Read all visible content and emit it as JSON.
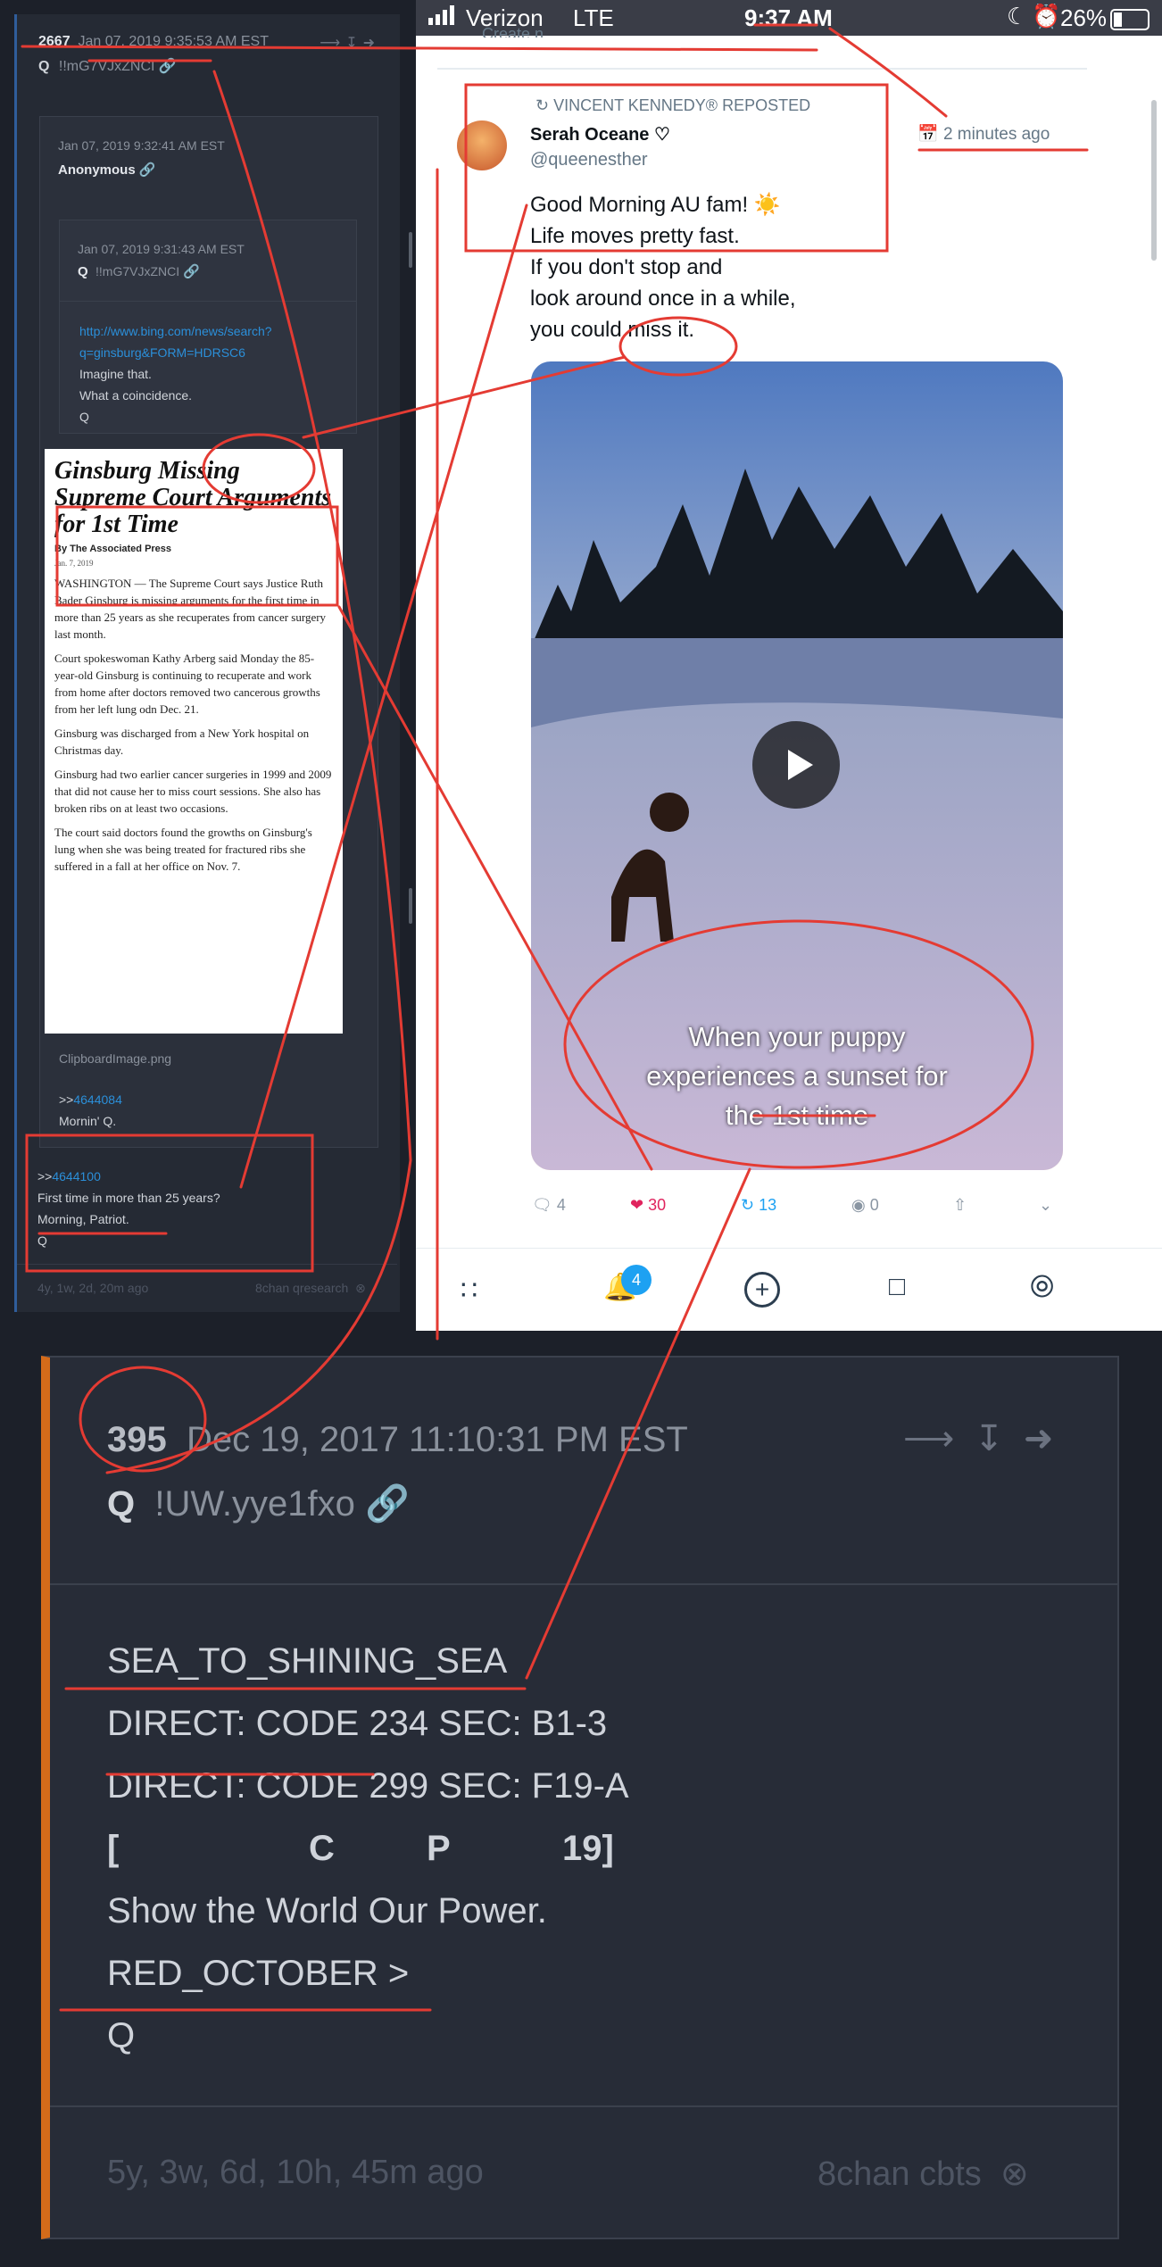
{
  "left_panel": {
    "post_number": "2667",
    "timestamp": "Jan 07, 2019 9:35:53 AM EST",
    "author_name": "Q",
    "tripcode": "!!mG7VJxZNCI",
    "quoted_post": {
      "timestamp": "Jan 07, 2019 9:32:41 AM EST",
      "author": "Anonymous",
      "nested_post": {
        "timestamp": "Jan 07, 2019 9:31:43 AM EST",
        "author_name": "Q",
        "tripcode": "!!mG7VJxZNCI",
        "link_line1": "http://www.bing.com/news/search?",
        "link_line2": "q=ginsburg&FORM=HDRSC6",
        "line1": "Imagine that.",
        "line2": "What a coincidence.",
        "sign": "Q"
      },
      "article": {
        "headline": "Ginsburg Missing Supreme Court Arguments for 1st Time",
        "byline": "By The Associated Press",
        "dateline": "Jan. 7, 2019",
        "paragraphs": [
          "WASHINGTON — The Supreme Court says Justice Ruth Bader Ginsburg is missing arguments for the first time in more than 25 years as she recuperates from cancer surgery last month.",
          "Court spokeswoman Kathy Arberg said Monday the 85-year-old Ginsburg is continuing to recuperate and work from home after doctors removed two cancerous growths from her left lung odn Dec. 21.",
          "Ginsburg was discharged from a New York hospital on Christmas day.",
          "Ginsburg had two earlier cancer surgeries in 1999 and 2009 that did not cause her to miss court sessions. She also has broken ribs on at least two occasions.",
          "The court said doctors found the growths on Ginsburg's lung when she was being treated for fractured ribs she suffered in a fall at her office on Nov. 7."
        ]
      },
      "attachment_name": "ClipboardImage.png",
      "reply_prefix": ">>",
      "reply_ref": "4644084",
      "reply_text": "Mornin' Q."
    },
    "ref_prefix": ">>",
    "ref": "4644100",
    "body_line1": "First time in more than 25 years?",
    "body_line2": "Morning, Patriot.",
    "body_sign": "Q",
    "footer_age": "4y, 1w, 2d, 20m ago",
    "footer_source": "8chan qresearch"
  },
  "status_bar": {
    "carrier": "Verizon",
    "network": "LTE",
    "time": "9:37 AM",
    "battery": "26%"
  },
  "tweet": {
    "truncated_above": "Create n...",
    "reposted_by": "VINCENT KENNEDY® REPOSTED",
    "name": "Serah Oceane",
    "name_emoji": "♡",
    "handle": "@queenesther",
    "time_ago": "2 minutes ago",
    "text_lines": [
      "Good Morning AU fam! ☀️",
      "Life moves pretty fast.",
      "If you don't stop and",
      "look around once in a while,",
      "you could miss it."
    ],
    "video_caption_line1": "When your puppy",
    "video_caption_line2": "experiences a sunset for",
    "video_caption_line3": "the 1st time",
    "replies": "4",
    "likes": "30",
    "retweets": "13",
    "views": "0"
  },
  "tab_bar": {
    "notifications_badge": "4"
  },
  "big_post": {
    "post_number": "395",
    "timestamp": "Dec 19, 2017 11:10:31 PM EST",
    "author_name": "Q",
    "tripcode": "!UW.yye1fxo",
    "lines": [
      "SEA_TO_SHINING_SEA",
      "DIRECT: CODE 234 SEC: B1-3",
      "DIRECT: CODE 299 SEC: F19-A"
    ],
    "bracket_open": "[",
    "bracket_c": "C",
    "bracket_p": "P",
    "bracket_close": "19]",
    "line_show": "Show the World Our Power.",
    "line_red": "RED_OCTOBER >",
    "sign": "Q",
    "footer_age": "5y, 3w, 6d, 10h, 45m ago",
    "footer_source": "8chan cbts"
  },
  "colors": {
    "annotation_red": "#e43b33",
    "link_blue": "#2b8fd9",
    "like_red": "#e0245e",
    "retweet_blue": "#1da1f2",
    "post_accent": "#d46b1a"
  }
}
